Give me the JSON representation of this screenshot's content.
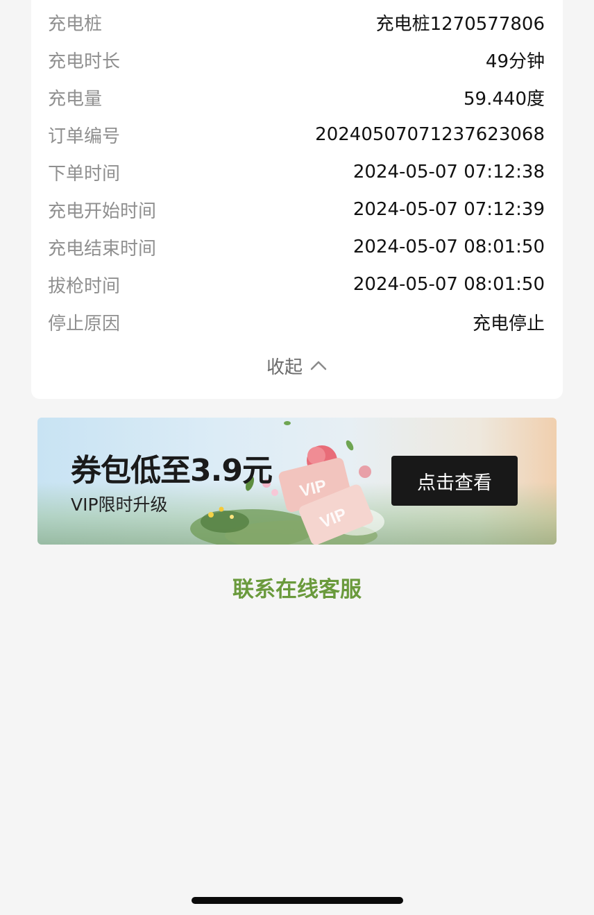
{
  "details": [
    {
      "label": "充电桩",
      "value": "充电桩1270577806"
    },
    {
      "label": "充电时长",
      "value": "49分钟"
    },
    {
      "label": "充电量",
      "value": "59.440度"
    },
    {
      "label": "订单编号",
      "value": "20240507071237623068"
    },
    {
      "label": "下单时间",
      "value": "2024-05-07 07:12:38"
    },
    {
      "label": "充电开始时间",
      "value": "2024-05-07 07:12:39"
    },
    {
      "label": "充电结束时间",
      "value": "2024-05-07 08:01:50"
    },
    {
      "label": "拔枪时间",
      "value": "2024-05-07 08:01:50"
    },
    {
      "label": "停止原因",
      "value": "充电停止"
    }
  ],
  "collapse": {
    "label": "收起",
    "icon": "chevron-up-icon"
  },
  "banner": {
    "title": "券包低至3.9元",
    "subtitle": "VIP限时升级",
    "button": "点击查看",
    "badge_text": "VIP"
  },
  "contact": {
    "label": "联系在线客服",
    "color": "#6a9a3c"
  },
  "colors": {
    "label": "#8f8f8f",
    "value": "#111111",
    "background": "#f5f5f5",
    "card": "#ffffff",
    "button": "#181818"
  }
}
